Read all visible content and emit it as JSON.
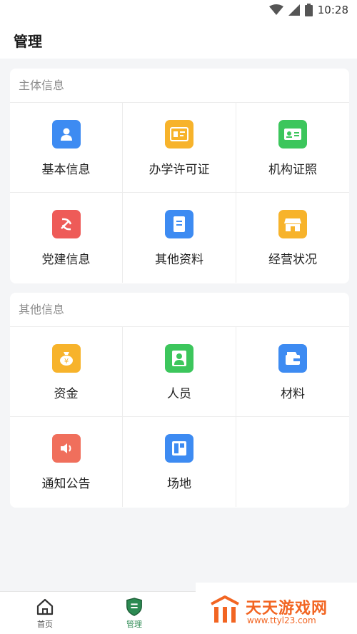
{
  "status_bar": {
    "time": "10:28"
  },
  "header": {
    "title": "管理"
  },
  "sections": [
    {
      "title": "主体信息",
      "items": [
        {
          "label": "基本信息",
          "icon": "user-card-icon",
          "color": "#3d8bf2"
        },
        {
          "label": "办学许可证",
          "icon": "license-icon",
          "color": "#f7b32b"
        },
        {
          "label": "机构证照",
          "icon": "id-card-icon",
          "color": "#3cc65c"
        },
        {
          "label": "党建信息",
          "icon": "party-emblem-icon",
          "color": "#ee5b58"
        },
        {
          "label": "其他资料",
          "icon": "document-icon",
          "color": "#3d8bf2"
        },
        {
          "label": "经营状况",
          "icon": "shop-icon",
          "color": "#f7b32b"
        }
      ]
    },
    {
      "title": "其他信息",
      "items": [
        {
          "label": "资金",
          "icon": "money-bag-icon",
          "color": "#f7b32b"
        },
        {
          "label": "人员",
          "icon": "person-icon",
          "color": "#3cc65c"
        },
        {
          "label": "材料",
          "icon": "wallet-icon",
          "color": "#3d8bf2"
        },
        {
          "label": "通知公告",
          "icon": "speaker-icon",
          "color": "#f06f5c"
        },
        {
          "label": "场地",
          "icon": "layout-icon",
          "color": "#3d8bf2"
        }
      ]
    }
  ],
  "bottom_nav": {
    "items": [
      {
        "label": "首页",
        "icon": "home-icon"
      },
      {
        "label": "管理",
        "icon": "manage-shield-icon",
        "active": true
      }
    ],
    "active_color": "#2c8a52"
  },
  "watermark": {
    "text": "天天游戏网",
    "url": "www.ttyl23.com",
    "color": "#f26522"
  }
}
